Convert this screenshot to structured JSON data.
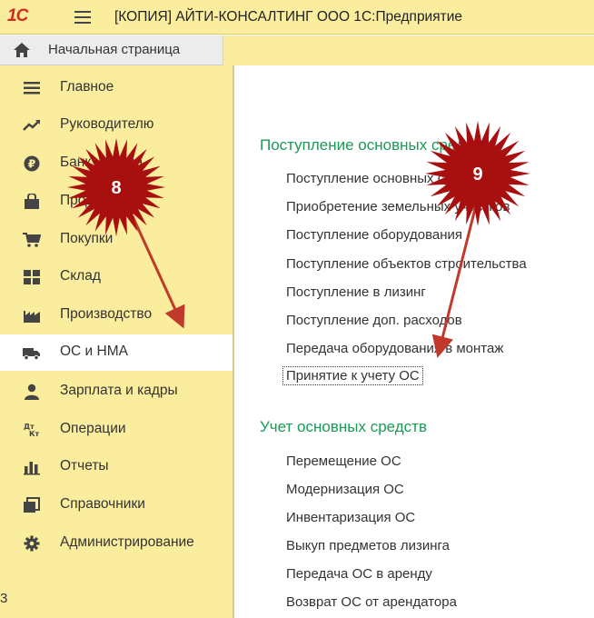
{
  "app": {
    "logo": "1С",
    "title": "[КОПИЯ] АЙТИ-КОНСАЛТИНГ ООО 1С:Предприятие"
  },
  "home": {
    "label": "Начальная страница"
  },
  "sidebar": {
    "items": [
      {
        "label": "Главное",
        "icon": "list-icon"
      },
      {
        "label": "Руководителю",
        "icon": "trend-icon"
      },
      {
        "label": "Банк и касса",
        "icon": "ruble-icon"
      },
      {
        "label": "Продажи",
        "icon": "bag-icon"
      },
      {
        "label": "Покупки",
        "icon": "cart-icon"
      },
      {
        "label": "Склад",
        "icon": "warehouse-icon"
      },
      {
        "label": "Производство",
        "icon": "factory-icon"
      },
      {
        "label": "ОС и НМА",
        "icon": "truck-icon",
        "active": true
      },
      {
        "label": "Зарплата и кадры",
        "icon": "person-icon"
      },
      {
        "label": "Операции",
        "icon": "dt-kt-icon",
        "icon_text": [
          "Дт",
          "Кт"
        ]
      },
      {
        "label": "Отчеты",
        "icon": "bar-chart-icon"
      },
      {
        "label": "Справочники",
        "icon": "books-icon"
      },
      {
        "label": "Администрирование",
        "icon": "gear-icon"
      }
    ]
  },
  "content": {
    "sections": [
      {
        "title": "Поступление основных средств",
        "links": [
          "Поступление основных средств",
          "Приобретение земельных участков",
          "Поступление оборудования",
          "Поступление объектов строительства",
          "Поступление в лизинг",
          "Поступление доп. расходов",
          "Передача оборудования в монтаж",
          "Принятие к учету ОС"
        ]
      },
      {
        "title": "Учет основных средств",
        "links": [
          "Перемещение ОС",
          "Модернизация ОС",
          "Инвентаризация ОС",
          "Выкуп предметов лизинга",
          "Передача ОС в аренду",
          "Возврат ОС от арендатора"
        ]
      }
    ]
  },
  "annotations": {
    "badge_8": "8",
    "badge_9": "9",
    "badge_color": "#a80f0f",
    "arrow_color": "#c0392b"
  },
  "stray_text": "3"
}
